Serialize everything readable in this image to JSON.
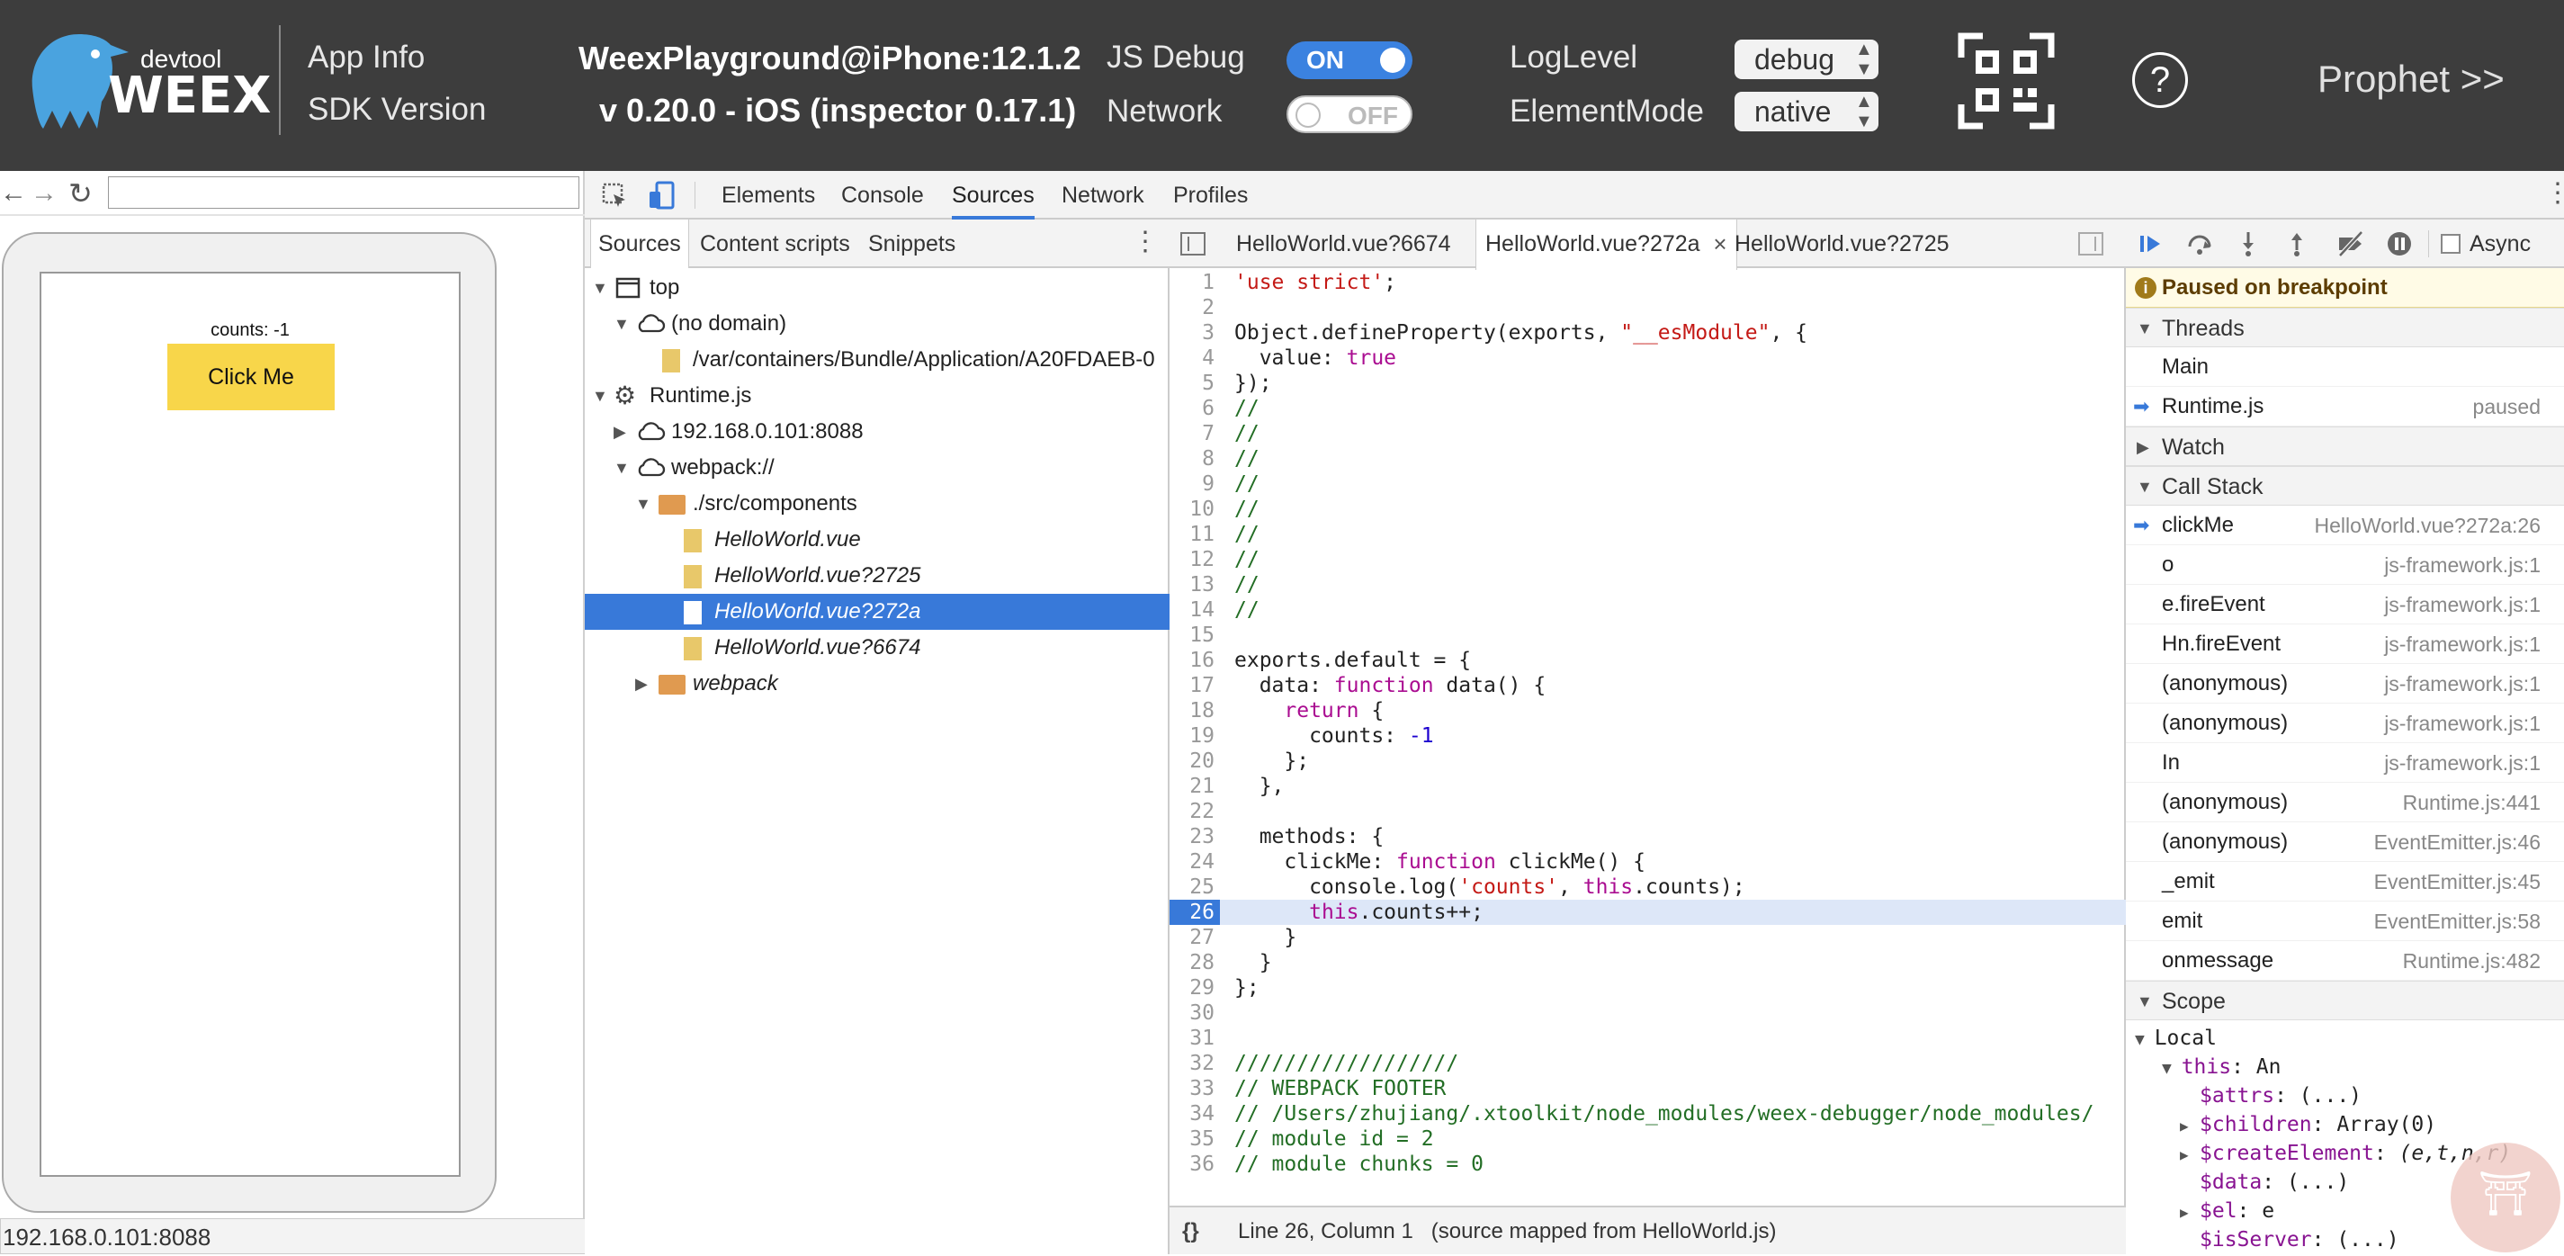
{
  "header": {
    "logo_text_small": "devtool",
    "logo_text_big": "WEEX",
    "app_info_label": "App Info",
    "sdk_version_label": "SDK Version",
    "app_info_value": "WeexPlayground@iPhone:12.1.2",
    "sdk_version_value": "v 0.20.0 - iOS (inspector 0.17.1)",
    "js_debug_label": "JS Debug",
    "js_debug_state": "ON",
    "network_label": "Network",
    "network_state": "OFF",
    "loglevel_label": "LogLevel",
    "loglevel_value": "debug",
    "elementmode_label": "ElementMode",
    "elementmode_value": "native",
    "help_icon": "question-icon",
    "prophet_link": "Prophet >>"
  },
  "preview": {
    "counts_text": "counts: -1",
    "button_label": "Click Me",
    "button_color": "#f8d64a",
    "status_url": "192.168.0.101:8088"
  },
  "devtools": {
    "tabs": [
      "Elements",
      "Console",
      "Sources",
      "Network",
      "Profiles"
    ],
    "active_tab": "Sources",
    "navigator": {
      "tabs": [
        "Sources",
        "Content scripts",
        "Snippets"
      ],
      "tree": [
        {
          "label": "top"
        },
        {
          "label": "(no domain)"
        },
        {
          "label": "/var/containers/Bundle/Application/A20FDAEB-0"
        },
        {
          "label": "Runtime.js"
        },
        {
          "label": "192.168.0.101:8088"
        },
        {
          "label": "webpack://"
        },
        {
          "label": "./src/components"
        },
        {
          "label": "HelloWorld.vue"
        },
        {
          "label": "HelloWorld.vue?2725"
        },
        {
          "label": "HelloWorld.vue?272a"
        },
        {
          "label": "HelloWorld.vue?6674"
        },
        {
          "label": "webpack"
        }
      ]
    },
    "editor": {
      "tabs": [
        "HelloWorld.vue?6674",
        "HelloWorld.vue?272a",
        "HelloWorld.vue?2725"
      ],
      "active_tab": "HelloWorld.vue?272a",
      "current_line": 26,
      "status": "Line 26, Column 1   (source mapped from HelloWorld.js)",
      "lines": [
        "'use strict';",
        "",
        "Object.defineProperty(exports, \"__esModule\", {",
        "  value: true",
        "});",
        "//",
        "//",
        "//",
        "//",
        "//",
        "//",
        "//",
        "//",
        "//",
        "",
        "exports.default = {",
        "  data: function data() {",
        "    return {",
        "      counts: -1",
        "    };",
        "  },",
        "",
        "  methods: {",
        "    clickMe: function clickMe() {",
        "      console.log('counts', this.counts);",
        "      this.counts++;",
        "    }",
        "  }",
        "};",
        "",
        "",
        "//////////////////",
        "// WEBPACK FOOTER",
        "// /Users/zhujiang/.xtoolkit/node_modules/weex-debugger/node_modules/",
        "// module id = 2",
        "// module chunks = 0"
      ]
    },
    "debugger": {
      "async_label": "Async",
      "paused_text": "Paused on breakpoint",
      "threads_label": "Threads",
      "threads": [
        {
          "name": "Main",
          "state": ""
        },
        {
          "name": "Runtime.js",
          "state": "paused"
        }
      ],
      "watch_label": "Watch",
      "callstack_label": "Call Stack",
      "callstack": [
        {
          "fn": "clickMe",
          "loc": "HelloWorld.vue?272a:26"
        },
        {
          "fn": "o",
          "loc": "js-framework.js:1"
        },
        {
          "fn": "e.fireEvent",
          "loc": "js-framework.js:1"
        },
        {
          "fn": "Hn.fireEvent",
          "loc": "js-framework.js:1"
        },
        {
          "fn": "(anonymous)",
          "loc": "js-framework.js:1"
        },
        {
          "fn": "(anonymous)",
          "loc": "js-framework.js:1"
        },
        {
          "fn": "In",
          "loc": "js-framework.js:1"
        },
        {
          "fn": "(anonymous)",
          "loc": "Runtime.js:441"
        },
        {
          "fn": "(anonymous)",
          "loc": "EventEmitter.js:46"
        },
        {
          "fn": "_emit",
          "loc": "EventEmitter.js:45"
        },
        {
          "fn": "emit",
          "loc": "EventEmitter.js:58"
        },
        {
          "fn": "onmessage",
          "loc": "Runtime.js:482"
        }
      ],
      "scope_label": "Scope",
      "local_label": "Local",
      "this_label": "this",
      "this_value": "An",
      "scope_props": [
        {
          "name": "$attrs",
          "value": "(...)"
        },
        {
          "name": "$children",
          "value": "Array(0)"
        },
        {
          "name": "$createElement",
          "value": "(e,t,n,r)"
        },
        {
          "name": "$data",
          "value": "(...)"
        },
        {
          "name": "$el",
          "value": "e"
        },
        {
          "name": "$isServer",
          "value": "(...)"
        }
      ]
    }
  }
}
